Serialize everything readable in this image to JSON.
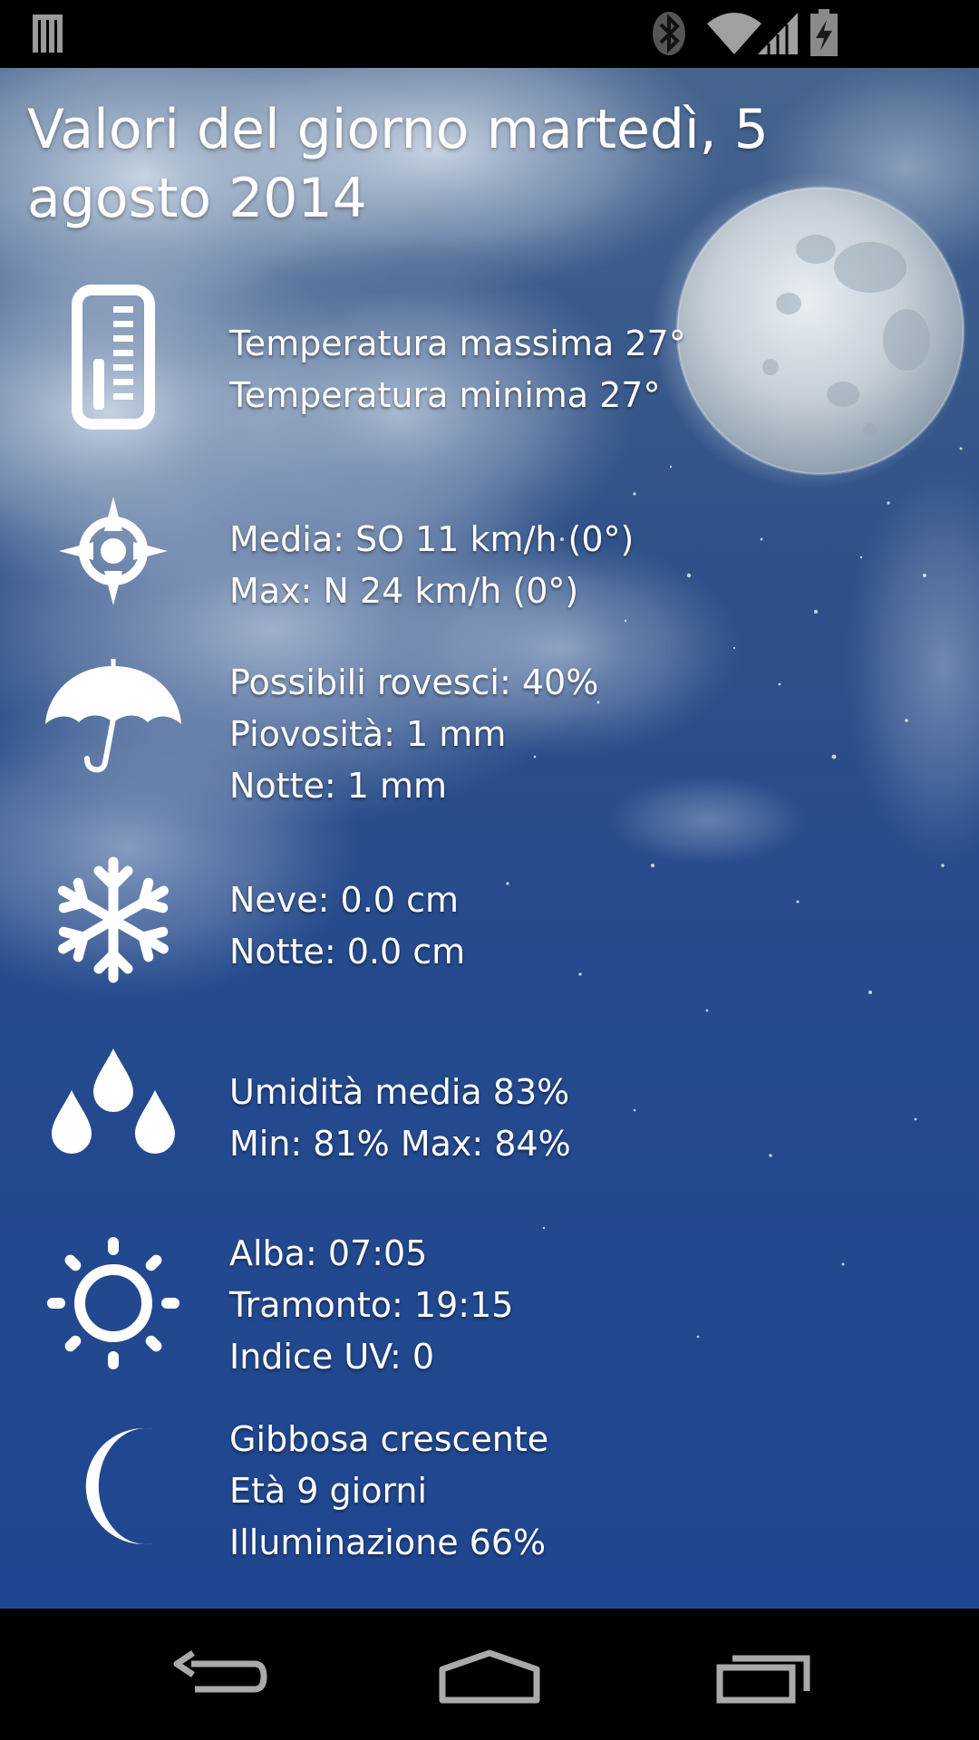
{
  "title": "Valori del giorno martedì, 5 agosto 2014",
  "rows": {
    "temperature": {
      "icon": "thermometer-icon",
      "lines": [
        "Temperatura massima 27°",
        "Temperatura minima 27°"
      ]
    },
    "wind": {
      "icon": "compass-icon",
      "lines": [
        "Media: SO 11 km/h (0°)",
        "Max: N 24 km/h (0°)"
      ]
    },
    "rain": {
      "icon": "umbrella-icon",
      "lines": [
        "Possibili rovesci: 40%",
        "Piovosità: 1 mm",
        "Notte: 1 mm"
      ]
    },
    "snow": {
      "icon": "snowflake-icon",
      "lines": [
        "Neve: 0.0 cm",
        "Notte: 0.0 cm"
      ]
    },
    "humidity": {
      "icon": "droplets-icon",
      "lines": [
        "Umidità media 83%",
        "Min: 81% Max: 84%"
      ]
    },
    "sun": {
      "icon": "sun-icon",
      "lines": [
        "Alba: 07:05",
        "Tramonto: 19:15",
        "Indice UV: 0"
      ]
    },
    "moon": {
      "icon": "crescent-moon-icon",
      "lines": [
        "Gibbosa crescente",
        "Età 9 giorni",
        "Illuminazione 66%"
      ]
    }
  },
  "status_bar": {
    "icons": [
      "notification-bars-icon",
      "bluetooth-icon",
      "wifi-icon",
      "cell-signal-icon",
      "battery-charging-icon"
    ]
  },
  "nav_bar": {
    "icons": [
      "back-icon",
      "home-icon",
      "recent-apps-icon"
    ]
  },
  "colors": {
    "sky_top": "#46648e",
    "sky_bottom": "#1f4690",
    "text": "#ffffff"
  }
}
